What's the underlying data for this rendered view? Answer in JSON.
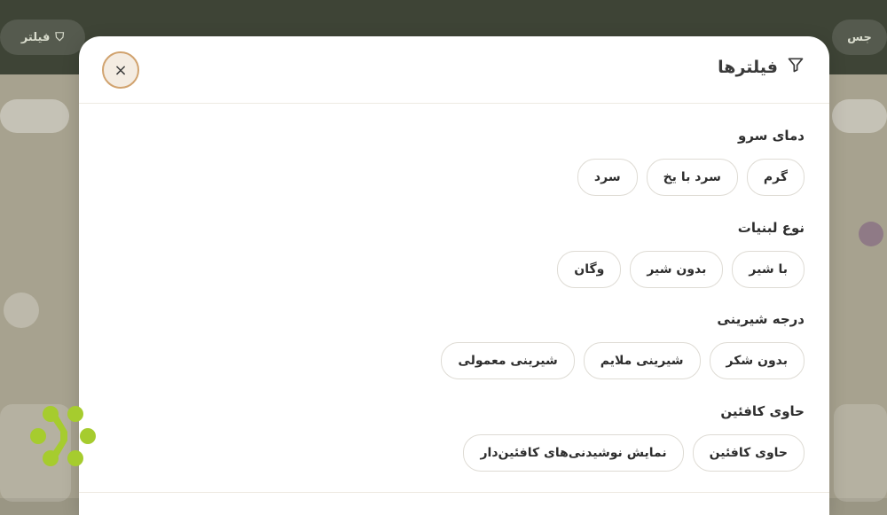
{
  "background": {
    "top_left_label": "فیلتر",
    "top_right_label": "جس",
    "colors": {
      "overlay": "#9a9684",
      "header": "#3e4436"
    }
  },
  "modal": {
    "title": "فیلترها",
    "title_icon": "filter-icon",
    "close_icon": "close-icon",
    "close_symbol": "×",
    "sections": [
      {
        "title": "دمای سرو",
        "options": [
          "گرم",
          "سرد با یخ",
          "سرد"
        ]
      },
      {
        "title": "نوع لبنیات",
        "options": [
          "با شیر",
          "بدون شیر",
          "وگان"
        ]
      },
      {
        "title": "درجه شیرینی",
        "options": [
          "بدون شکر",
          "شیرینی ملایم",
          "شیرینی معمولی"
        ]
      },
      {
        "title": "حاوی کافئین",
        "options": [
          "حاوی کافئین",
          "نمایش نوشیدنی‌های کافئین‌دار"
        ]
      }
    ],
    "colors": {
      "close_border": "#d1a36f",
      "close_bg": "#f4ece2",
      "chip_border": "#dedbd4"
    }
  },
  "watermark": {
    "icon": "brand-logo-icon",
    "color": "#a6cc2e"
  }
}
